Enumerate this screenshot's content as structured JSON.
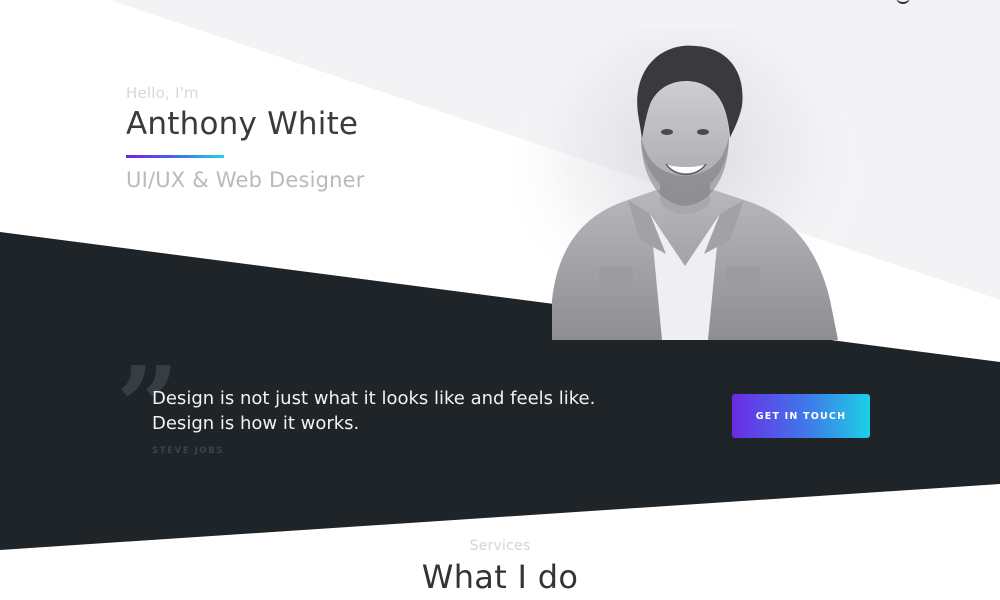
{
  "hero": {
    "greeting": "Hello, I'm",
    "name": "Anthony White",
    "role": "UI/UX & Web Designer"
  },
  "quote": {
    "mark": "”",
    "lines": [
      "Design is not just what it looks like and feels like.",
      "Design is how it works."
    ],
    "author": "STEVE JOBS"
  },
  "cta": {
    "label": "GET IN TOUCH"
  },
  "services": {
    "eyebrow": "Services",
    "title": "What I do"
  },
  "colors": {
    "dark_band": "#1e2428",
    "light_panel": "#f3f3f6",
    "accent_gradient": [
      "#6a2be6",
      "#1cd0e6"
    ]
  },
  "icons": {
    "portrait": "avatar-photo",
    "quote": "quote-icon"
  }
}
